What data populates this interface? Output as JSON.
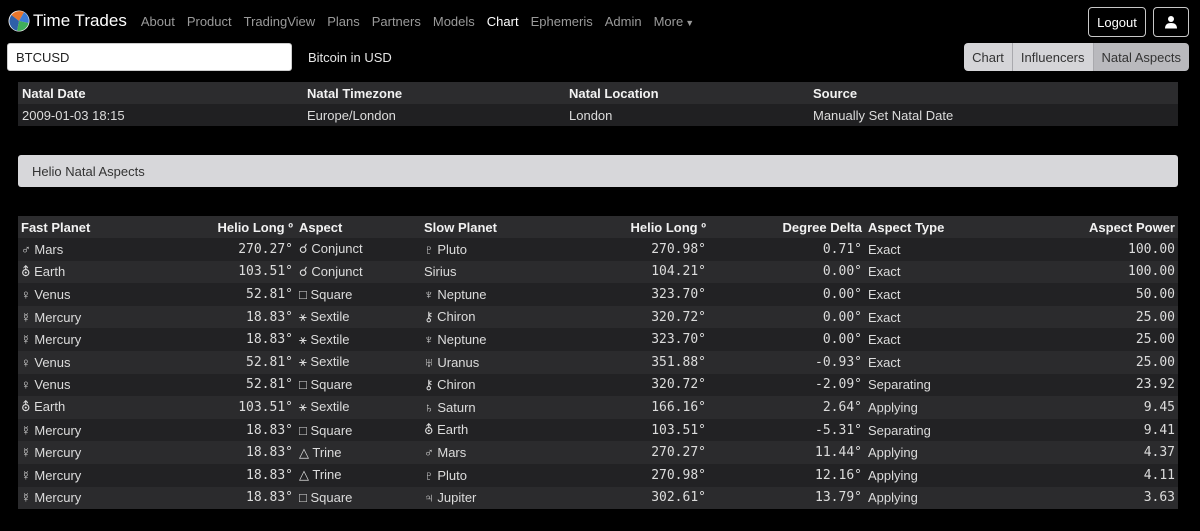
{
  "nav": {
    "brand": "Time Trades",
    "links": [
      {
        "label": "About"
      },
      {
        "label": "Product"
      },
      {
        "label": "TradingView"
      },
      {
        "label": "Plans"
      },
      {
        "label": "Partners"
      },
      {
        "label": "Models"
      },
      {
        "label": "Chart",
        "active": true
      },
      {
        "label": "Ephemeris"
      },
      {
        "label": "Admin"
      },
      {
        "label": "More"
      }
    ],
    "logout_label": "Logout",
    "user_icon": "user-icon",
    "colors": {
      "background": "#000000",
      "link": "#9a9a9a",
      "active_link": "#ffffff"
    }
  },
  "toolbar": {
    "symbol_value": "BTCUSD",
    "symbol_name": "Bitcoin in USD",
    "view_buttons": [
      {
        "label": "Chart"
      },
      {
        "label": "Influencers"
      },
      {
        "label": "Natal Aspects",
        "active": true
      }
    ]
  },
  "natal": {
    "headers": [
      "Natal Date",
      "Natal Timezone",
      "Natal Location",
      "Source"
    ],
    "row": [
      "2009-01-03 18:15",
      "Europe/London",
      "London",
      "Manually Set Natal Date"
    ]
  },
  "section_title": "Helio Natal Aspects",
  "aspects": {
    "headers": [
      "Fast Planet",
      "Helio Long º",
      "Aspect",
      "Slow Planet",
      "Helio Long º",
      "Degree Delta",
      "Aspect Type",
      "Aspect Power"
    ],
    "rows": [
      [
        "♂ Mars",
        "270.27°",
        "☌ Conjunct",
        "♇ Pluto",
        "270.98°",
        "0.71°",
        "Exact",
        "100.00"
      ],
      [
        "⛢ Earth",
        "103.51°",
        "☌ Conjunct",
        "Sirius",
        "104.21°",
        "0.00°",
        "Exact",
        "100.00"
      ],
      [
        "♀ Venus",
        "52.81°",
        "□ Square",
        "♆ Neptune",
        "323.70°",
        "0.00°",
        "Exact",
        "50.00"
      ],
      [
        "☿ Mercury",
        "18.83°",
        "⚹ Sextile",
        "⚷ Chiron",
        "320.72°",
        "0.00°",
        "Exact",
        "25.00"
      ],
      [
        "☿ Mercury",
        "18.83°",
        "⚹ Sextile",
        "♆ Neptune",
        "323.70°",
        "0.00°",
        "Exact",
        "25.00"
      ],
      [
        "♀ Venus",
        "52.81°",
        "⚹ Sextile",
        "♅ Uranus",
        "351.88°",
        "-0.93°",
        "Exact",
        "25.00"
      ],
      [
        "♀ Venus",
        "52.81°",
        "□ Square",
        "⚷ Chiron",
        "320.72°",
        "-2.09°",
        "Separating",
        "23.92"
      ],
      [
        "⛢ Earth",
        "103.51°",
        "⚹ Sextile",
        "♄ Saturn",
        "166.16°",
        "2.64°",
        "Applying",
        "9.45"
      ],
      [
        "☿ Mercury",
        "18.83°",
        "□ Square",
        "⛢ Earth",
        "103.51°",
        "-5.31°",
        "Separating",
        "9.41"
      ],
      [
        "☿ Mercury",
        "18.83°",
        "△ Trine",
        "♂ Mars",
        "270.27°",
        "11.44°",
        "Applying",
        "4.37"
      ],
      [
        "☿ Mercury",
        "18.83°",
        "△ Trine",
        "♇ Pluto",
        "270.98°",
        "12.16°",
        "Applying",
        "4.11"
      ],
      [
        "☿ Mercury",
        "18.83°",
        "□ Square",
        "♃ Jupiter",
        "302.61°",
        "13.79°",
        "Applying",
        "3.63"
      ]
    ],
    "colors": {
      "number": "#e0528f",
      "row_odd": "#222224",
      "row_even": "#2b2b2d",
      "header": "#2c2c2e"
    }
  }
}
